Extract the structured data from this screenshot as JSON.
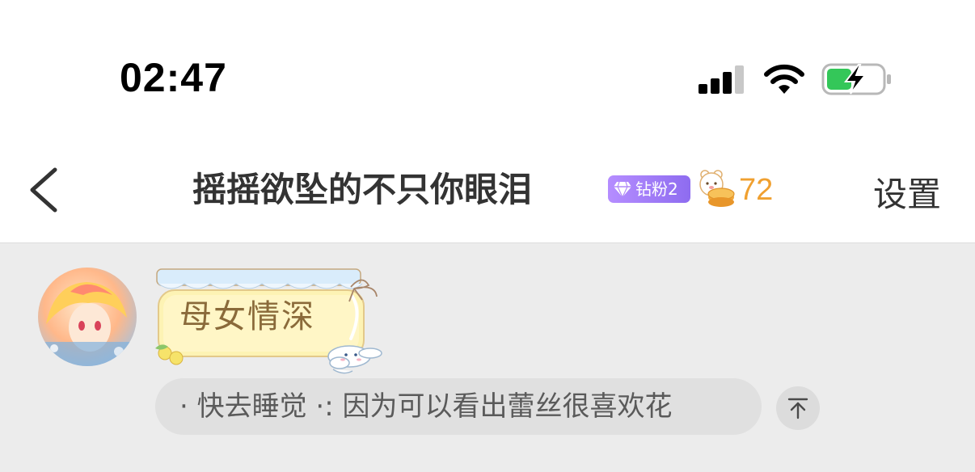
{
  "status_bar": {
    "time": "02:47"
  },
  "nav": {
    "title": "摇摇欲坠的不只你眼泪",
    "badge_level": "钻粉2",
    "fan_count": "72",
    "settings_label": "设置"
  },
  "profile": {
    "nameplate_text": "母女情深"
  },
  "message": {
    "text": "· 快去睡觉 ·: 因为可以看出蕾丝很喜欢花"
  },
  "colors": {
    "badge_purple": "#a07cf8",
    "fan_orange": "#f0a030",
    "battery_green": "#34c759",
    "page_bg": "#ececec"
  },
  "icons": {
    "back": "chevron-left-icon",
    "signal": "cellular-signal-icon",
    "wifi": "wifi-icon",
    "battery": "battery-charging-icon",
    "gem": "diamond-icon",
    "fan": "bear-mooncake-icon",
    "pin": "pin-to-top-icon"
  }
}
